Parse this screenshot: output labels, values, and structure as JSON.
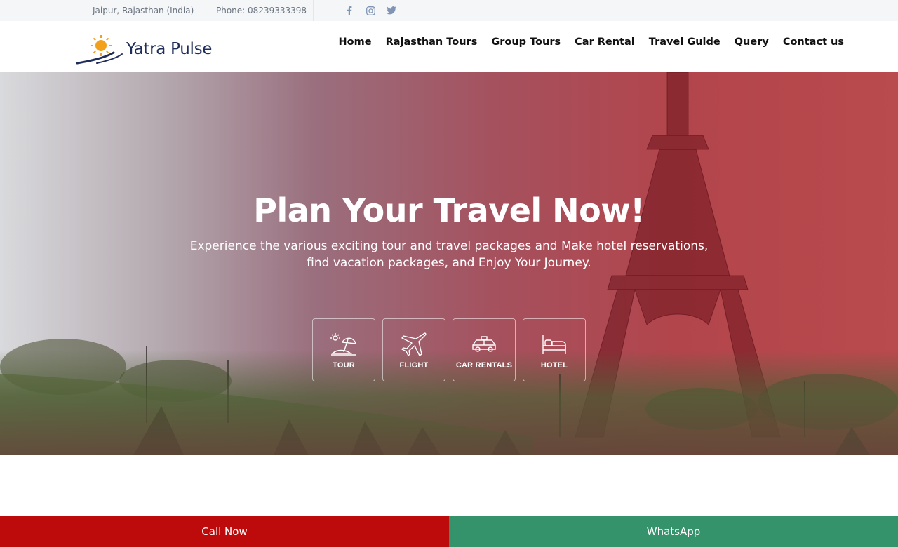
{
  "topbar": {
    "location": "Jaipur, Rajasthan (India)",
    "phone": "Phone: 08239333398",
    "social_icons": [
      "facebook-icon",
      "instagram-icon",
      "twitter-icon"
    ]
  },
  "brand": {
    "name": "Yatra Pulse",
    "logo_icon": "sun-road-logo",
    "colors": {
      "sun": "#f2a11c",
      "road": "#1f2d5a"
    }
  },
  "nav": {
    "items": [
      {
        "label": "Home"
      },
      {
        "label": "Rajasthan Tours"
      },
      {
        "label": "Group Tours"
      },
      {
        "label": "Car Rental"
      },
      {
        "label": "Travel Guide"
      },
      {
        "label": "Query"
      },
      {
        "label": "Contact us"
      }
    ]
  },
  "hero": {
    "title": "Plan Your Travel Now!",
    "subtitle_line1": "Experience the various exciting tour and travel packages and Make hotel reservations,",
    "subtitle_line2": "find vacation packages, and Enjoy Your Journey.",
    "services": [
      {
        "label": "TOUR",
        "icon": "beach-umbrella-icon"
      },
      {
        "label": "FLIGHT",
        "icon": "airplane-icon"
      },
      {
        "label": "CAR RENTALS",
        "icon": "taxi-icon"
      },
      {
        "label": "HOTEL",
        "icon": "bed-icon"
      }
    ]
  },
  "bottom_bar": {
    "call_label": "Call Now",
    "whatsapp_label": "WhatsApp",
    "colors": {
      "call": "#bd0a0a",
      "whatsapp": "#35936b"
    }
  }
}
